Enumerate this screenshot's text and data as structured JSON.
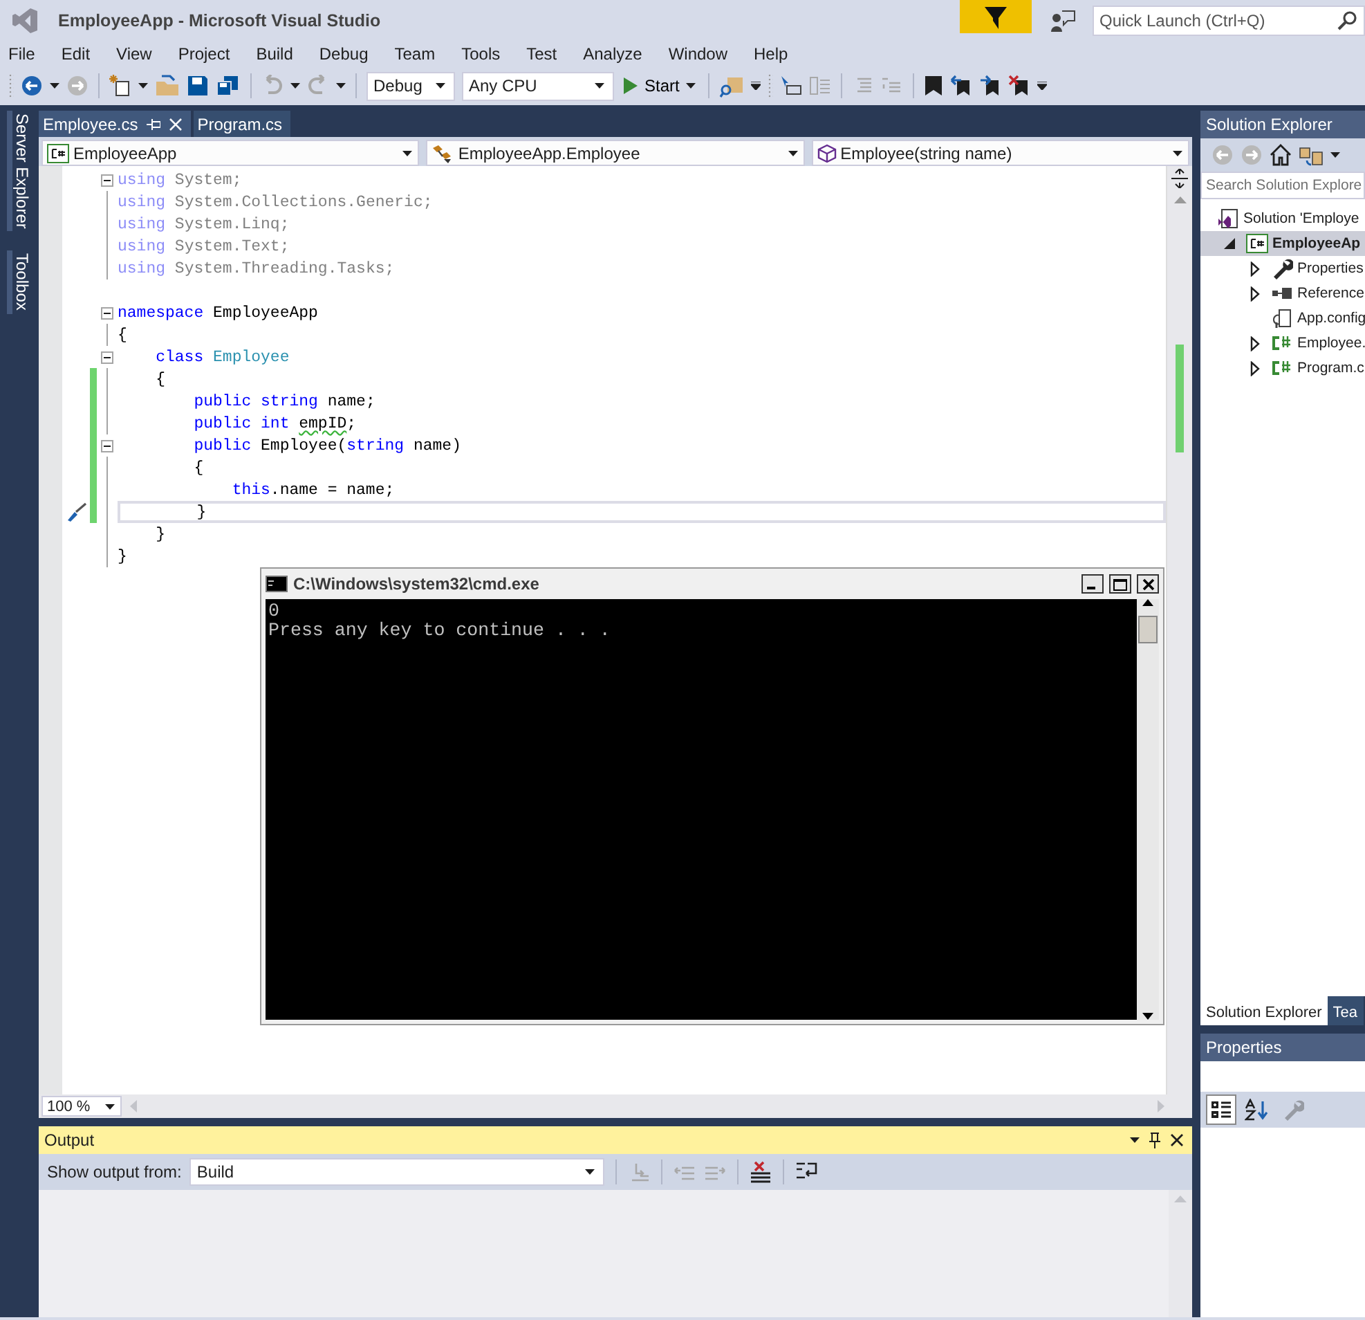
{
  "window": {
    "title": "EmployeeApp - Microsoft Visual Studio"
  },
  "quick_launch": {
    "placeholder": "Quick Launch (Ctrl+Q)"
  },
  "menu": [
    "File",
    "Edit",
    "View",
    "Project",
    "Build",
    "Debug",
    "Team",
    "Tools",
    "Test",
    "Analyze",
    "Window",
    "Help"
  ],
  "toolbar": {
    "configuration": "Debug",
    "platform": "Any CPU",
    "start": "Start"
  },
  "side_tabs": [
    "Server Explorer",
    "Toolbox"
  ],
  "editor": {
    "tabs": [
      {
        "label": "Employee.cs",
        "selected": true
      },
      {
        "label": "Program.cs",
        "selected": false
      }
    ],
    "nav": [
      {
        "kind": "project",
        "label": "EmployeeApp"
      },
      {
        "kind": "class",
        "label": "EmployeeApp.Employee"
      },
      {
        "kind": "method",
        "label": "Employee(string name)"
      }
    ],
    "lines": [
      {
        "kind": "code",
        "foldable": true,
        "changed": false,
        "current": false,
        "quick_action": false,
        "tokens": [
          {
            "text": "using",
            "kind": "kw-dim"
          },
          {
            "text": " System;",
            "kind": "text-dim"
          }
        ]
      },
      {
        "kind": "code",
        "foldable": false,
        "changed": false,
        "current": false,
        "quick_action": false,
        "tokens": [
          {
            "text": "using",
            "kind": "kw-dim"
          },
          {
            "text": " System.Collections.Generic;",
            "kind": "text-dim"
          }
        ]
      },
      {
        "kind": "code",
        "foldable": false,
        "changed": false,
        "current": false,
        "quick_action": false,
        "tokens": [
          {
            "text": "using",
            "kind": "kw-dim"
          },
          {
            "text": " System.Linq;",
            "kind": "text-dim"
          }
        ]
      },
      {
        "kind": "code",
        "foldable": false,
        "changed": false,
        "current": false,
        "quick_action": false,
        "tokens": [
          {
            "text": "using",
            "kind": "kw-dim"
          },
          {
            "text": " System.Text;",
            "kind": "text-dim"
          }
        ]
      },
      {
        "kind": "code",
        "foldable": false,
        "changed": false,
        "current": false,
        "quick_action": false,
        "tokens": [
          {
            "text": "using",
            "kind": "kw-dim"
          },
          {
            "text": " System.Threading.Tasks;",
            "kind": "text-dim"
          }
        ]
      },
      {
        "kind": "blank"
      },
      {
        "kind": "code",
        "foldable": true,
        "changed": false,
        "current": false,
        "quick_action": false,
        "tokens": [
          {
            "text": "namespace",
            "kind": "kw"
          },
          {
            "text": " EmployeeApp",
            "kind": "text"
          }
        ]
      },
      {
        "kind": "code",
        "foldable": false,
        "changed": false,
        "current": false,
        "quick_action": false,
        "tokens": [
          {
            "text": "{",
            "kind": "text"
          }
        ]
      },
      {
        "kind": "code",
        "foldable": true,
        "changed": false,
        "current": false,
        "quick_action": false,
        "tokens": [
          {
            "text": "    class ",
            "kind": "kw"
          },
          {
            "text": "Employee",
            "kind": "type"
          }
        ]
      },
      {
        "kind": "code",
        "foldable": false,
        "changed": true,
        "current": false,
        "quick_action": false,
        "tokens": [
          {
            "text": "    {",
            "kind": "text"
          }
        ]
      },
      {
        "kind": "code",
        "foldable": false,
        "changed": true,
        "current": false,
        "quick_action": false,
        "tokens": [
          {
            "text": "        public string",
            "kind": "kw"
          },
          {
            "text": " name;",
            "kind": "text"
          }
        ]
      },
      {
        "kind": "code",
        "foldable": false,
        "changed": true,
        "current": false,
        "quick_action": false,
        "tokens": [
          {
            "text": "        public int ",
            "kind": "kw"
          },
          {
            "text": "empID",
            "kind": "squiggle"
          },
          {
            "text": ";",
            "kind": "text"
          }
        ]
      },
      {
        "kind": "code",
        "foldable": true,
        "changed": true,
        "current": false,
        "quick_action": false,
        "tokens": [
          {
            "text": "        public ",
            "kind": "kw"
          },
          {
            "text": "Employee(",
            "kind": "text"
          },
          {
            "text": "string",
            "kind": "kw"
          },
          {
            "text": " name)",
            "kind": "text"
          }
        ]
      },
      {
        "kind": "code",
        "foldable": false,
        "changed": true,
        "current": false,
        "quick_action": false,
        "tokens": [
          {
            "text": "        {",
            "kind": "text"
          }
        ]
      },
      {
        "kind": "code",
        "foldable": false,
        "changed": true,
        "current": false,
        "quick_action": false,
        "tokens": [
          {
            "text": "            this",
            "kind": "kw"
          },
          {
            "text": ".name = name;",
            "kind": "text"
          }
        ]
      },
      {
        "kind": "code",
        "foldable": false,
        "changed": true,
        "current": true,
        "quick_action": true,
        "tokens": [
          {
            "text": "        }",
            "kind": "text"
          }
        ]
      },
      {
        "kind": "code",
        "foldable": false,
        "changed": false,
        "current": false,
        "quick_action": false,
        "tokens": [
          {
            "text": "    }",
            "kind": "text"
          }
        ]
      },
      {
        "kind": "code",
        "foldable": false,
        "changed": false,
        "current": false,
        "quick_action": false,
        "tokens": [
          {
            "text": "}",
            "kind": "text"
          }
        ]
      }
    ],
    "zoom": "100 %"
  },
  "console": {
    "title": "C:\\Windows\\system32\\cmd.exe",
    "lines": [
      "0",
      "Press any key to continue . . ."
    ]
  },
  "output": {
    "title": "Output",
    "source_label": "Show output from:",
    "source": "Build"
  },
  "solution_explorer": {
    "title": "Solution Explorer",
    "search": {
      "placeholder": "Search Solution Explore"
    },
    "tree": [
      {
        "kind": "solution",
        "label": "Solution 'Employe",
        "selected": false,
        "expanded": true,
        "children": [
          {
            "kind": "project",
            "label": "EmployeeAp",
            "selected": true,
            "expanded": true,
            "children": [
              {
                "kind": "properties",
                "label": "Properties",
                "selected": false,
                "expanded": false
              },
              {
                "kind": "references",
                "label": "Reference",
                "selected": false,
                "expanded": false
              },
              {
                "kind": "config",
                "label": "App.config",
                "selected": false
              },
              {
                "kind": "csharp",
                "label": "Employee.",
                "selected": false,
                "expanded": false
              },
              {
                "kind": "csharp",
                "label": "Program.c",
                "selected": false,
                "expanded": false
              }
            ]
          }
        ]
      }
    ]
  },
  "panel_tabs": [
    {
      "label": "Solution Explorer",
      "selected": true
    },
    {
      "label": "Tea",
      "selected": false
    }
  ],
  "properties": {
    "title": "Properties",
    "buttons": [
      {
        "kind": "categorized",
        "selected": true,
        "disabled": false
      },
      {
        "kind": "alphabetical",
        "selected": false,
        "disabled": false
      },
      {
        "kind": "property-pages",
        "selected": false,
        "disabled": true
      }
    ]
  }
}
